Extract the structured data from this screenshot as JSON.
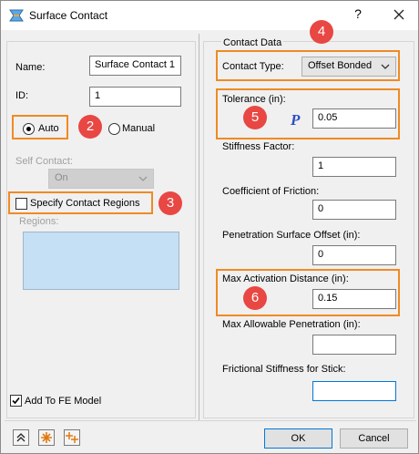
{
  "window": {
    "title": "Surface Contact",
    "help": "?",
    "close_icon": "close-icon"
  },
  "left": {
    "name_label": "Name:",
    "name_value": "Surface Contact 1",
    "id_label": "ID:",
    "id_value": "1",
    "auto_label": "Auto",
    "auto_selected": true,
    "manual_label": "Manual",
    "manual_selected": false,
    "self_contact_label": "Self Contact:",
    "self_contact_value": "On",
    "specify_regions_label": "Specify Contact Regions",
    "specify_regions_checked": false,
    "regions_label": "Regions:",
    "add_to_fe_label": "Add To FE Model",
    "add_to_fe_checked": true
  },
  "right": {
    "group_title": "Contact Data",
    "contact_type_label": "Contact Type:",
    "contact_type_value": "Offset Bonded",
    "tolerance_label": "Tolerance (in):",
    "tolerance_value": "0.05",
    "param_icon_text": "P",
    "stiffness_label": "Stiffness Factor:",
    "stiffness_value": "1",
    "friction_label": "Coefficient of Friction:",
    "friction_value": "0",
    "penetration_offset_label": "Penetration Surface Offset (in):",
    "penetration_offset_value": "0",
    "max_activation_label": "Max Activation Distance (in):",
    "max_activation_value": "0.15",
    "max_allowable_label": "Max Allowable Penetration (in):",
    "max_allowable_value": "",
    "frictional_stiffness_label": "Frictional Stiffness for Stick:",
    "frictional_stiffness_value": ""
  },
  "annotations": {
    "badges": [
      "2",
      "3",
      "4",
      "5",
      "6"
    ],
    "accent": "#f08a24",
    "badge_color": "#e84743"
  },
  "footer": {
    "ok_label": "OK",
    "cancel_label": "Cancel"
  }
}
